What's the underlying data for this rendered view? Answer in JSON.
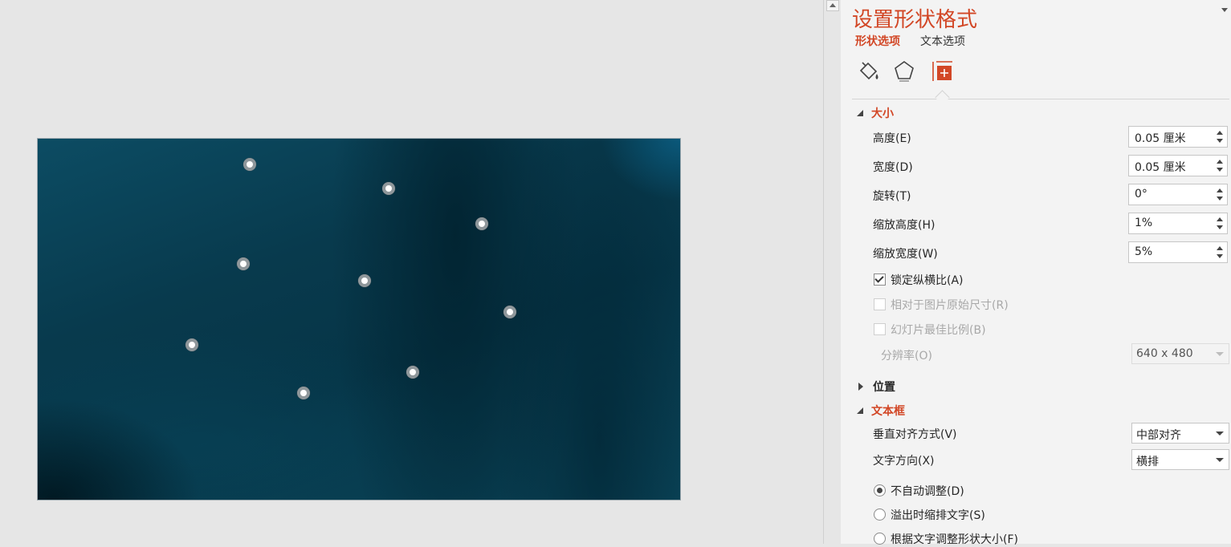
{
  "pane": {
    "title": "设置形状格式",
    "tabs": {
      "shape": "形状选项",
      "text": "文本选项"
    },
    "icons": [
      "fill-line-icon",
      "effects-pentagon-icon",
      "size-properties-icon"
    ],
    "accent_color": "#d24726"
  },
  "size_section": {
    "title": "大小",
    "height_label": "高度(E)",
    "height_value": "0.05 厘米",
    "width_label": "宽度(D)",
    "width_value": "0.05 厘米",
    "rotation_label": "旋转(T)",
    "rotation_value": "0°",
    "scale_height_label": "缩放高度(H)",
    "scale_height_value": "1%",
    "scale_width_label": "缩放宽度(W)",
    "scale_width_value": "5%",
    "lock_aspect_label": "锁定纵横比(A)",
    "lock_aspect_checked": true,
    "relative_original_label": "相对于图片原始尺寸(R)",
    "best_scale_label": "幻灯片最佳比例(B)",
    "resolution_label": "分辨率(O)",
    "resolution_value": "640 x 480"
  },
  "position_section": {
    "title": "位置"
  },
  "textbox_section": {
    "title": "文本框",
    "valign_label": "垂直对齐方式(V)",
    "valign_value": "中部对齐",
    "direction_label": "文字方向(X)",
    "direction_value": "横排",
    "radio_no_autofit": "不自动调整(D)",
    "radio_shrink_overflow": "溢出时缩排文字(S)",
    "radio_resize_shape": "根据文字调整形状大小(F)",
    "selected_radio": "不自动调整(D)"
  }
}
